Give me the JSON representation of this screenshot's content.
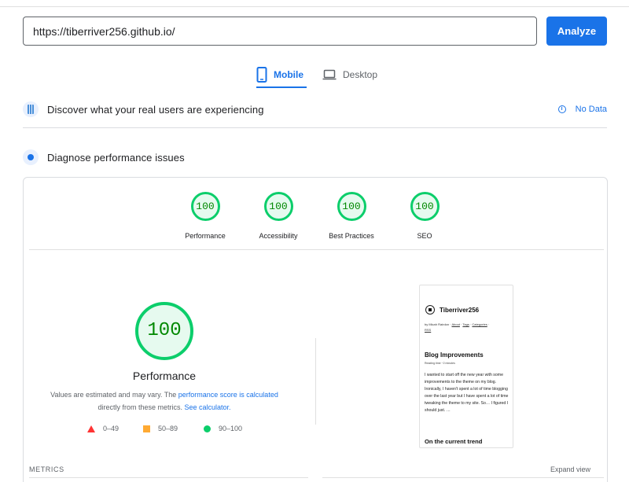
{
  "header": {
    "url_value": "https://tiberriver256.github.io/",
    "analyze_label": "Analyze"
  },
  "tabs": {
    "mobile_label": "Mobile",
    "desktop_label": "Desktop",
    "mobile_icon": "smartphone-icon",
    "desktop_icon": "laptop-icon",
    "active": "Mobile"
  },
  "field_data": {
    "title": "Discover what your real users are experiencing",
    "status": "No Data",
    "icon": "users-chart-icon"
  },
  "diagnose": {
    "title": "Diagnose performance issues",
    "icon": "lighthouse-icon"
  },
  "scores": [
    {
      "label": "Performance",
      "value": "100"
    },
    {
      "label": "Accessibility",
      "value": "100"
    },
    {
      "label": "Best Practices",
      "value": "100"
    },
    {
      "label": "SEO",
      "value": "100"
    }
  ],
  "performance": {
    "score": "100",
    "title": "Performance",
    "desc_prefix": "Values are estimated and may vary. The ",
    "desc_link1": "performance score is calculated",
    "desc_middle": " directly from these metrics. ",
    "desc_link2": "See calculator."
  },
  "legend": [
    {
      "range": "0–49",
      "shape": "triangle",
      "color": "#ff3333"
    },
    {
      "range": "50–89",
      "shape": "square",
      "color": "#ffaa33"
    },
    {
      "range": "90–100",
      "shape": "circle",
      "color": "#0cce6b"
    }
  ],
  "metrics": {
    "label": "METRICS",
    "expand_label": "Expand view"
  },
  "screenshot": {
    "brand": "Tiberriver256",
    "nav_prefix": "by Micah Rairdon · ",
    "nav_about": "About",
    "nav_tags": "Tags",
    "nav_categories": "Categories",
    "nav_rss": "RSS",
    "post_title": "Blog Improvements",
    "reading_time": "Reading time ~2 minutes",
    "body": "I wanted to start off the new year with some improvements to the theme on my blog. Ironically, I haven't spent a lot of time blogging over the last year but I have spent a lot of time tweaking the theme to my site. So… I figured I should just. …",
    "next_heading": "On the current trend"
  },
  "colors": {
    "accent": "#1a73e8",
    "pass": "#0cce6b",
    "pass_text": "#008800"
  }
}
